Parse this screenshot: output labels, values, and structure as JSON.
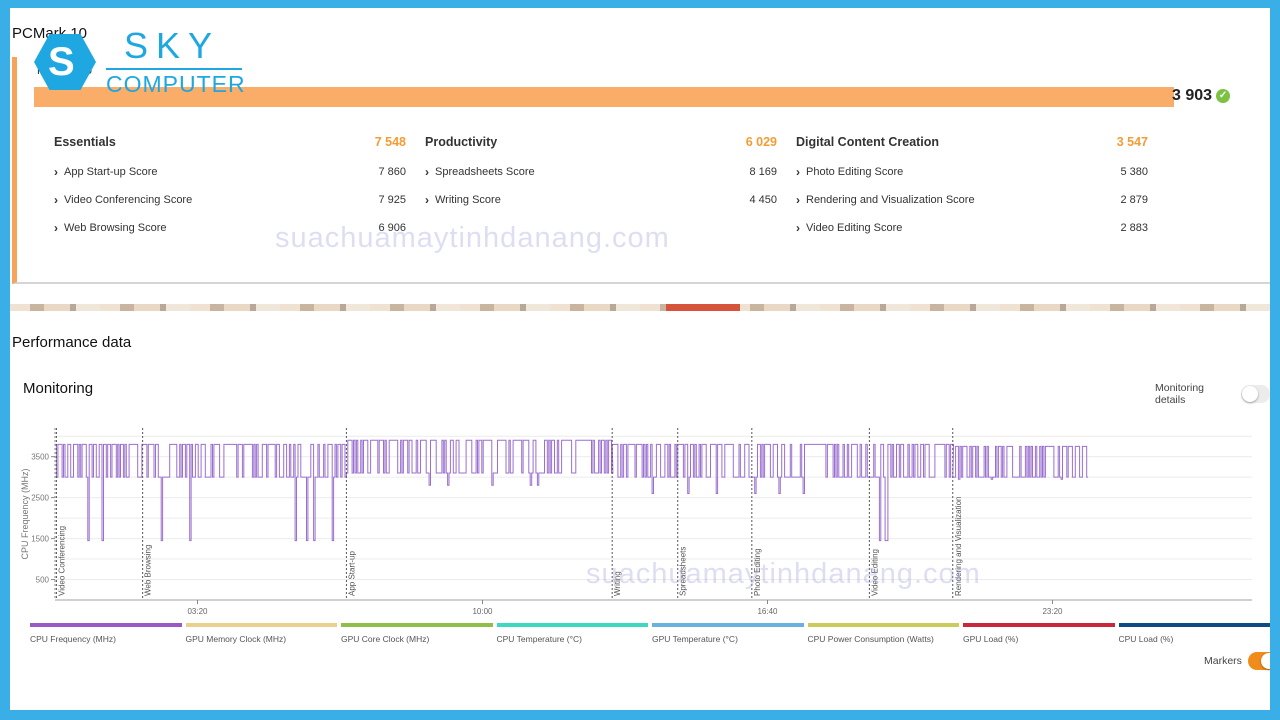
{
  "app": {
    "title": "PCMark 10",
    "logo": {
      "line1": "SKY",
      "line2": "COMPUTER",
      "glyph": "S"
    }
  },
  "result": {
    "subtitle": "PCMark 10",
    "total_score": "3 903",
    "status_icon": "check-circle-icon",
    "groups": [
      {
        "name": "Essentials",
        "score": "7 548",
        "items": [
          {
            "label": "App Start-up Score",
            "value": "7 860"
          },
          {
            "label": "Video Conferencing Score",
            "value": "7 925"
          },
          {
            "label": "Web Browsing Score",
            "value": "6 906"
          }
        ]
      },
      {
        "name": "Productivity",
        "score": "6 029",
        "items": [
          {
            "label": "Spreadsheets Score",
            "value": "8 169"
          },
          {
            "label": "Writing Score",
            "value": "4 450"
          }
        ]
      },
      {
        "name": "Digital Content Creation",
        "score": "3 547",
        "items": [
          {
            "label": "Photo Editing Score",
            "value": "5 380"
          },
          {
            "label": "Rendering and Visualization Score",
            "value": "2 879"
          },
          {
            "label": "Video Editing Score",
            "value": "2 883"
          }
        ]
      }
    ]
  },
  "watermark": "suachuamaytinhdanang.com",
  "performance": {
    "title": "Performance data",
    "monitoring_title": "Monitoring",
    "monitoring_details_label": "Monitoring details",
    "monitoring_details_on": false,
    "markers_label": "Markers",
    "markers_on": true
  },
  "colors": {
    "accent": "#f7a35c",
    "score": "#f39c34",
    "ok": "#7cc242",
    "cpu_line": "#9b6fd1",
    "frame": "#3aaee6"
  },
  "chart_data": {
    "type": "line",
    "title": "",
    "ylabel": "CPU Frequency (MHz)",
    "xlabel": "",
    "ylim": [
      0,
      4200
    ],
    "yticks": [
      500,
      1500,
      2500,
      3500
    ],
    "xlim": [
      0,
      1680
    ],
    "xticks": [
      {
        "t": 200,
        "label": "03:20"
      },
      {
        "t": 600,
        "label": "10:00"
      },
      {
        "t": 1000,
        "label": "16:40"
      },
      {
        "t": 1400,
        "label": "23:20"
      }
    ],
    "markers": [
      {
        "t": 2,
        "label": "Video Conferencing"
      },
      {
        "t": 123,
        "label": "Web Browsing"
      },
      {
        "t": 409,
        "label": "App Start-up"
      },
      {
        "t": 782,
        "label": "Writing"
      },
      {
        "t": 874,
        "label": "Spreadsheets"
      },
      {
        "t": 978,
        "label": "Photo Editing"
      },
      {
        "t": 1143,
        "label": "Video Editing"
      },
      {
        "t": 1260,
        "label": "Rendering and Visualization"
      }
    ],
    "series": [
      {
        "name": "CPU Frequency (MHz)",
        "segments": [
          {
            "from": 0,
            "to": 123,
            "base": 3000,
            "high": 3800,
            "low": 1450
          },
          {
            "from": 123,
            "to": 409,
            "base": 3000,
            "high": 3800,
            "low": 1450
          },
          {
            "from": 409,
            "to": 782,
            "base": 3100,
            "high": 3900,
            "low": 2800
          },
          {
            "from": 782,
            "to": 874,
            "base": 3000,
            "high": 3800,
            "low": 2600
          },
          {
            "from": 874,
            "to": 978,
            "base": 3000,
            "high": 3800,
            "low": 2600
          },
          {
            "from": 978,
            "to": 1143,
            "base": 3000,
            "high": 3800,
            "low": 2600
          },
          {
            "from": 1143,
            "to": 1260,
            "base": 3000,
            "high": 3800,
            "low": 1450
          },
          {
            "from": 1260,
            "to": 1450,
            "base": 3000,
            "high": 3750,
            "low": 2950
          }
        ]
      }
    ],
    "legend": [
      {
        "name": "CPU Frequency (MHz)",
        "color": "#9b59c6"
      },
      {
        "name": "GPU Memory Clock (MHz)",
        "color": "#e8d08e"
      },
      {
        "name": "GPU Core Clock (MHz)",
        "color": "#8fbf4a"
      },
      {
        "name": "CPU Temperature (°C)",
        "color": "#3ed8c2"
      },
      {
        "name": "GPU Temperature (°C)",
        "color": "#6ab1de"
      },
      {
        "name": "CPU Power Consumption (Watts)",
        "color": "#c9cb5a"
      },
      {
        "name": "GPU Load (%)",
        "color": "#c8283a"
      },
      {
        "name": "CPU Load (%)",
        "color": "#0e4a83"
      }
    ],
    "legend_position": "bottom",
    "grid": true
  }
}
